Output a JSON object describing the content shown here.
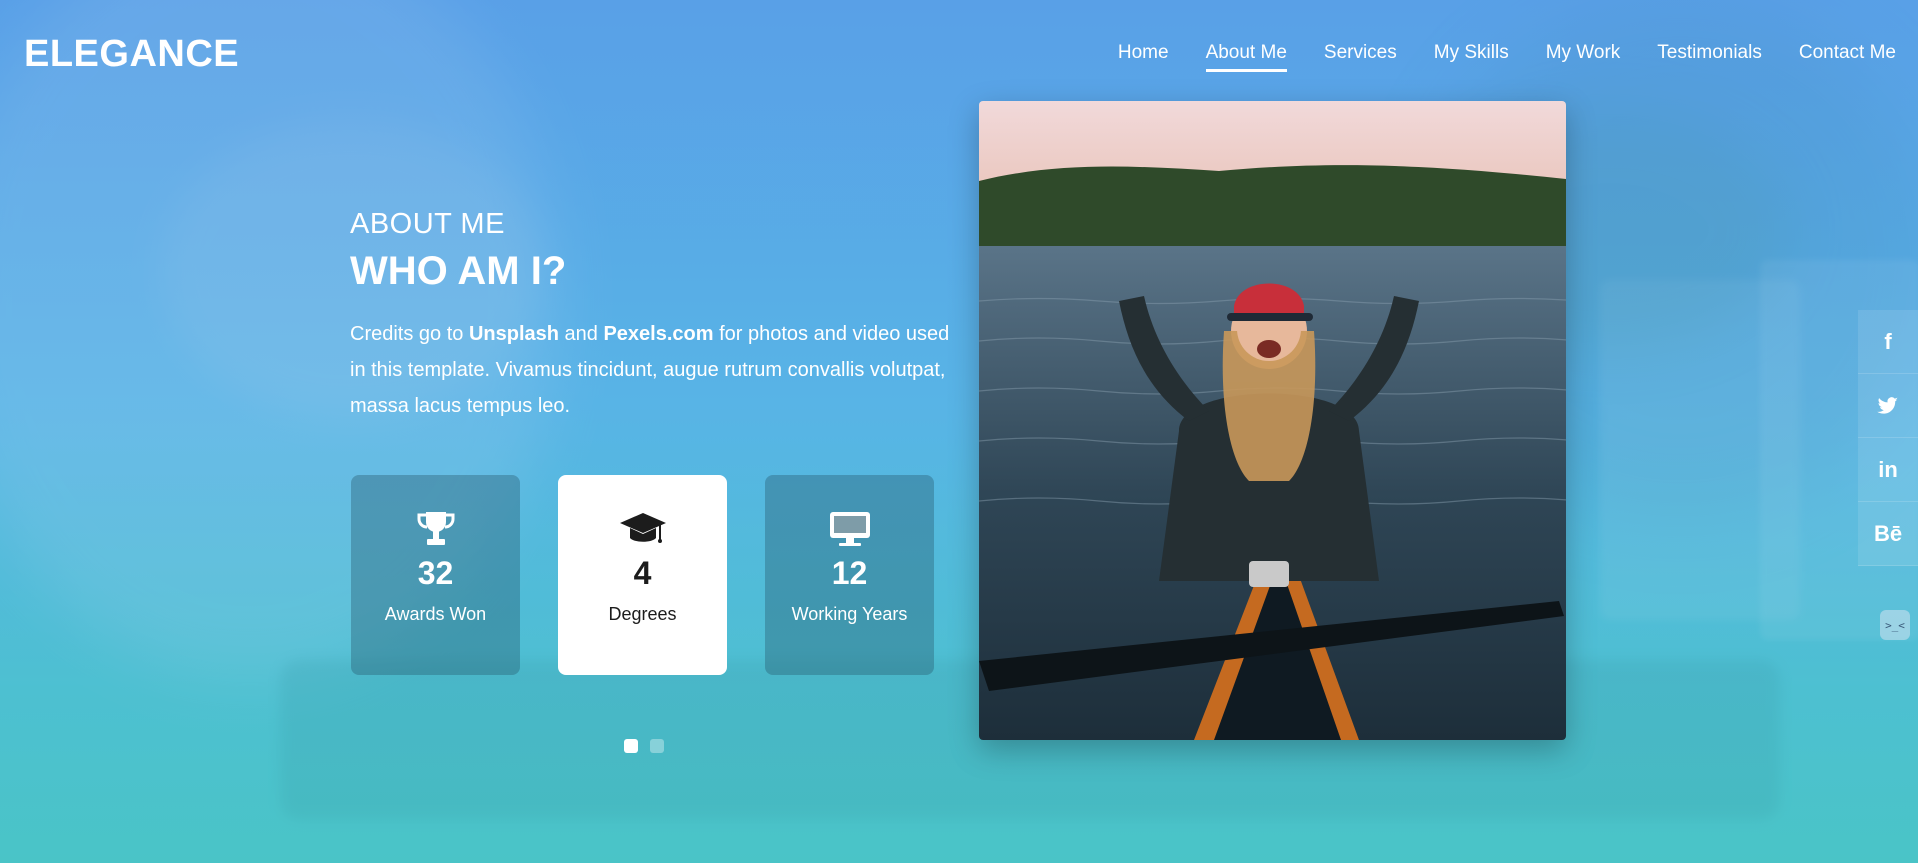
{
  "brand": {
    "logo": "ELEGANCE"
  },
  "nav": {
    "items": [
      {
        "label": "Home"
      },
      {
        "label": "About Me",
        "active": true
      },
      {
        "label": "Services"
      },
      {
        "label": "My Skills"
      },
      {
        "label": "My Work"
      },
      {
        "label": "Testimonials"
      },
      {
        "label": "Contact Me"
      }
    ]
  },
  "about": {
    "kicker": "ABOUT ME",
    "heading": "WHO AM I?",
    "desc_parts": {
      "p1": "Credits go to ",
      "b1": "Unsplash",
      "p2": " and ",
      "b2": "Pexels.com",
      "p3": " for photos and video used in this template. Vivamus tincidunt, augue rutrum convallis volutpat, massa lacus tempus leo."
    }
  },
  "stats": [
    {
      "icon": "trophy-icon",
      "value": "32",
      "label": "Awards Won"
    },
    {
      "icon": "graduation-cap-icon",
      "value": "4",
      "label": "Degrees"
    },
    {
      "icon": "monitor-icon",
      "value": "12",
      "label": "Working Years"
    }
  ],
  "carousel": {
    "pages": 2,
    "active": 1
  },
  "social": [
    {
      "icon": "facebook-icon",
      "glyph": "f"
    },
    {
      "icon": "twitter-icon",
      "glyph": ""
    },
    {
      "icon": "linkedin-icon",
      "glyph": "in"
    },
    {
      "icon": "behance-icon",
      "glyph": "Bē"
    }
  ],
  "colors": {
    "primary_gradient_top": "#5aa0e6",
    "primary_gradient_bottom": "#49c6c6",
    "card_dark": "rgba(40,90,110,0.38)",
    "card_light": "#ffffff"
  }
}
